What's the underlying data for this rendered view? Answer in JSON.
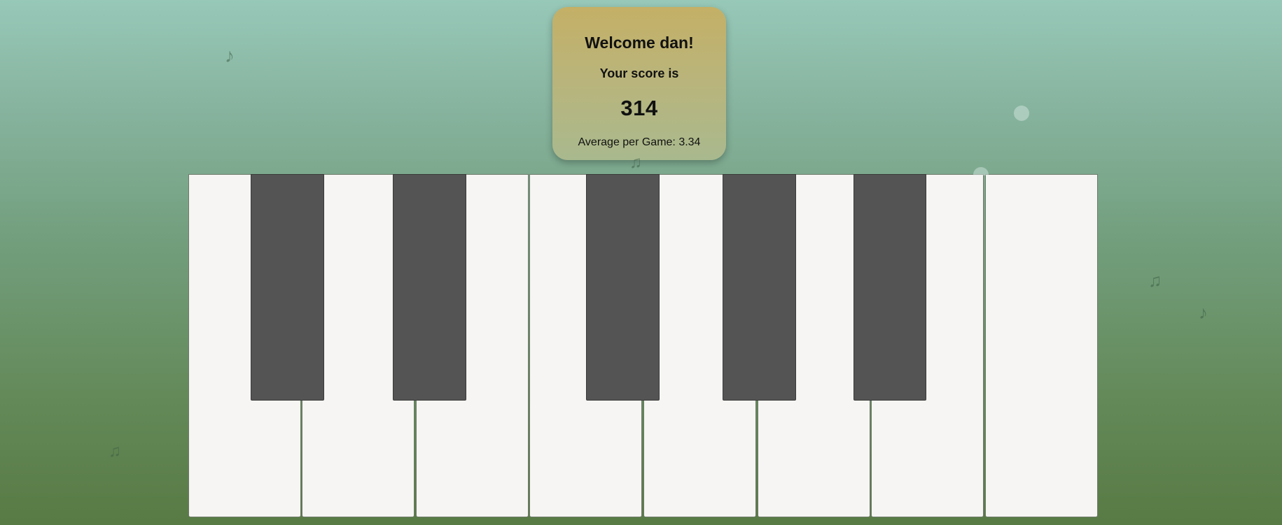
{
  "score_card": {
    "greeting": "Welcome dan!",
    "score_label": "Your score is",
    "score": "314",
    "average": "Average per Game: 3.34"
  },
  "piano": {
    "white_keys": [
      "white-key-1",
      "white-key-2",
      "white-key-3",
      "white-key-4",
      "white-key-5",
      "white-key-6",
      "white-key-7",
      "white-key-8"
    ],
    "black_keys": [
      "black-key-1",
      "black-key-2",
      "black-key-3",
      "black-key-4",
      "black-key-5"
    ]
  },
  "decorations": {
    "notes": [
      {
        "glyph": "♪",
        "icon": "eighth-note-icon"
      },
      {
        "glyph": "♫",
        "icon": "beamed-notes-icon"
      },
      {
        "glyph": "♫",
        "icon": "beamed-notes-icon"
      },
      {
        "glyph": "♪",
        "icon": "eighth-note-icon"
      },
      {
        "glyph": "♫",
        "icon": "beamed-notes-icon"
      }
    ]
  }
}
